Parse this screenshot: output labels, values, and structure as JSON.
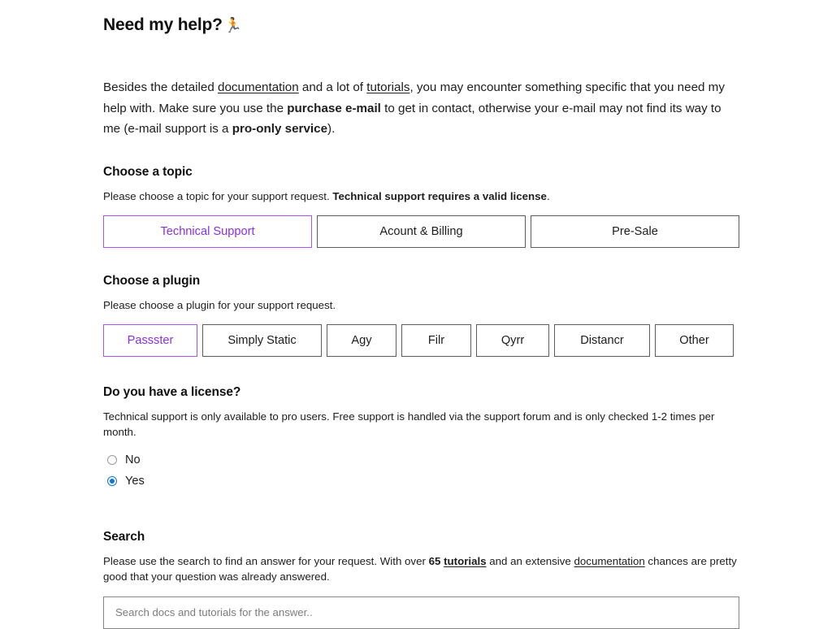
{
  "page": {
    "title": "Need my help?",
    "title_emoji": "🏃"
  },
  "intro": {
    "part1": "Besides the detailed ",
    "link_documentation": "documentation",
    "part2": " and a lot of ",
    "link_tutorials": "tutorials",
    "part3": ", you may encounter something specific that you need my help with. Make sure you use the ",
    "bold_purchase_email": "purchase e-mail",
    "part4": " to get in contact, otherwise your e-mail may not find its way to me (e-mail support is a ",
    "bold_pro_only": "pro-only service",
    "part5": ")."
  },
  "topic_section": {
    "heading": "Choose a topic",
    "description_plain": "Please choose a topic for your support request. ",
    "description_bold": "Technical support requires a valid license",
    "description_end": ".",
    "options": [
      {
        "label": "Technical Support",
        "selected": true
      },
      {
        "label": "Acount & Billing",
        "selected": false
      },
      {
        "label": "Pre-Sale",
        "selected": false
      }
    ]
  },
  "plugin_section": {
    "heading": "Choose a plugin",
    "description": "Please choose a plugin for your support request.",
    "options": [
      {
        "label": "Passster",
        "selected": true
      },
      {
        "label": "Simply Static",
        "selected": false
      },
      {
        "label": "Agy",
        "selected": false
      },
      {
        "label": "Filr",
        "selected": false
      },
      {
        "label": "Qyrr",
        "selected": false
      },
      {
        "label": "Distancr",
        "selected": false
      },
      {
        "label": "Other",
        "selected": false
      }
    ]
  },
  "license_section": {
    "heading": "Do you have a license?",
    "description": "Technical support is only available to pro users. Free support is handled via the support forum and is only checked 1-2 times per month.",
    "options": [
      {
        "label": "No",
        "checked": false
      },
      {
        "label": "Yes",
        "checked": true
      }
    ]
  },
  "search_section": {
    "heading": "Search",
    "description_part1": "Please use the search to find an answer for your request. With over ",
    "description_count": "65",
    "description_space1": " ",
    "link_tutorials": "tutorials",
    "description_part2": " and an extensive ",
    "link_documentation": "documentation",
    "description_part3": " chances are pretty good that your question was already answered.",
    "placeholder": "Search docs and tutorials for the answer..",
    "value": ""
  },
  "colors": {
    "accent_purple": "#8b2ff0",
    "accent_purple_border": "#a855f7",
    "radio_blue": "#1173d4",
    "border_gray": "#5c5c5c",
    "text": "#1d1d1d"
  }
}
